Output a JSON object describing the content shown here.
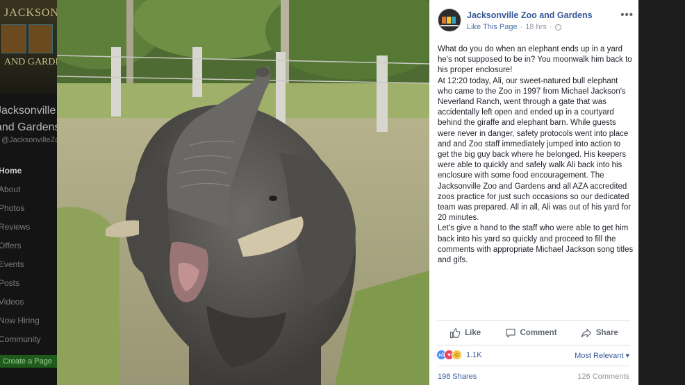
{
  "background_page": {
    "cover_title": "JACKSONVILLE",
    "cover_subtitle": "AND GARDENS",
    "page_name": "Jacksonville Zoo and Gardens",
    "handle": "@JacksonvilleZoo",
    "nav_items": [
      "Home",
      "About",
      "Photos",
      "Reviews",
      "Offers",
      "Events",
      "Posts",
      "Videos",
      "Now Hiring",
      "Community"
    ],
    "create_page_button": "Create a Page"
  },
  "post": {
    "page_name": "Jacksonville Zoo and Gardens",
    "like_page": "Like This Page",
    "separator": "·",
    "time": "18 hrs",
    "more": "•••",
    "paragraphs": [
      "What do you do when an elephant ends up in a yard he's not supposed to be in? You moonwalk him back to his proper enclosure!",
      "At 12:20 today, Ali, our sweet-natured bull elephant who came to the Zoo in 1997 from Michael Jackson's Neverland Ranch, went through a gate that was accidentally left open and ended up in a courtyard behind the giraffe and elephant barn. While guests were never in danger, safety protocols went into place and and Zoo staff immediately jumped into action to get the big guy back where he belonged. His keepers were able to quickly and safely walk Ali back into his enclosure with some food encouragement. The Jacksonville Zoo and Gardens and all AZA accredited zoos practice for just such occasions so our dedicated team was prepared. All in all, Ali was out of his yard for 20 minutes.",
      "Let's give a hand to the staff who were able to get him back into his yard so quickly and proceed to fill the comments with appropriate Michael Jackson song titles and gifs."
    ],
    "actions": {
      "like": "Like",
      "comment": "Comment",
      "share": "Share"
    },
    "reaction_count": "1.1K",
    "sort": "Most Relevant ▾",
    "shares": "198 Shares",
    "comments": "126 Comments"
  },
  "colors": {
    "link_blue": "#365899",
    "text": "#1d2129",
    "muted": "#90949c"
  },
  "icons": [
    "globe-icon",
    "more-icon",
    "like-icon",
    "comment-icon",
    "share-icon",
    "reaction-like-icon",
    "reaction-love-icon",
    "reaction-haha-icon"
  ]
}
